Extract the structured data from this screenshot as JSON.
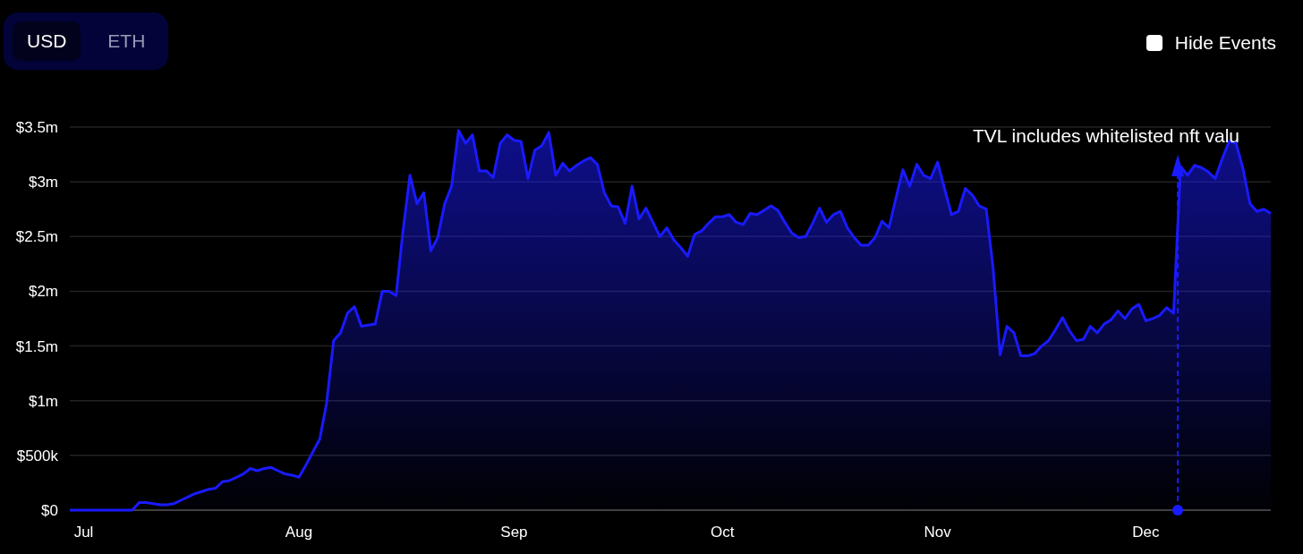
{
  "currency_toggle": [
    {
      "label": "USD",
      "selected": true
    },
    {
      "label": "ETH",
      "selected": false
    }
  ],
  "hide_events": {
    "label": "Hide Events",
    "checked": false
  },
  "chart_data": {
    "type": "area",
    "categories": [
      null,
      null,
      "Jul",
      null,
      null,
      null,
      null,
      null,
      null,
      null,
      null,
      null,
      null,
      null,
      null,
      null,
      null,
      null,
      null,
      null,
      null,
      null,
      null,
      null,
      null,
      null,
      null,
      null,
      null,
      null,
      null,
      null,
      null,
      "Aug",
      null,
      null,
      null,
      null,
      null,
      null,
      null,
      null,
      null,
      null,
      null,
      null,
      null,
      null,
      null,
      null,
      null,
      null,
      null,
      null,
      null,
      null,
      null,
      null,
      null,
      null,
      null,
      null,
      null,
      null,
      "Sep",
      null,
      null,
      null,
      null,
      null,
      null,
      null,
      null,
      null,
      null,
      null,
      null,
      null,
      null,
      null,
      null,
      null,
      null,
      null,
      null,
      null,
      null,
      null,
      null,
      null,
      null,
      null,
      null,
      null,
      "Oct",
      null,
      null,
      null,
      null,
      null,
      null,
      null,
      null,
      null,
      null,
      null,
      null,
      null,
      null,
      null,
      null,
      null,
      null,
      null,
      null,
      null,
      null,
      null,
      null,
      null,
      null,
      null,
      null,
      null,
      null,
      "Nov",
      null,
      null,
      null,
      null,
      null,
      null,
      null,
      null,
      null,
      null,
      null,
      null,
      null,
      null,
      null,
      null,
      null,
      null,
      null,
      null,
      null,
      null,
      null,
      null,
      null,
      null,
      null,
      null,
      null,
      "Dec",
      null,
      null,
      null,
      null,
      null,
      null,
      null,
      null,
      null,
      null,
      null,
      null,
      null,
      null,
      null,
      null,
      null,
      null
    ],
    "series": [
      {
        "color": "#1a1aff",
        "values": [
          0,
          0,
          0,
          0,
          0,
          0,
          0,
          0,
          0,
          0,
          70000,
          70000,
          60000,
          50000,
          50000,
          60000,
          90000,
          120000,
          150000,
          170000,
          190000,
          200000,
          260000,
          270000,
          300000,
          330000,
          380000,
          360000,
          380000,
          390000,
          360000,
          330000,
          320000,
          300000,
          410000,
          530000,
          650000,
          980000,
          1550000,
          1620000,
          1800000,
          1860000,
          1680000,
          1690000,
          1700000,
          2000000,
          2000000,
          1960000,
          2550000,
          3060000,
          2800000,
          2900000,
          2370000,
          2490000,
          2800000,
          2960000,
          3470000,
          3350000,
          3430000,
          3100000,
          3100000,
          3040000,
          3350000,
          3430000,
          3380000,
          3370000,
          3030000,
          3290000,
          3330000,
          3450000,
          3060000,
          3170000,
          3100000,
          3150000,
          3190000,
          3220000,
          3160000,
          2900000,
          2780000,
          2770000,
          2620000,
          2960000,
          2660000,
          2760000,
          2630000,
          2500000,
          2580000,
          2470000,
          2400000,
          2320000,
          2520000,
          2550000,
          2620000,
          2680000,
          2680000,
          2700000,
          2630000,
          2610000,
          2710000,
          2700000,
          2740000,
          2780000,
          2740000,
          2630000,
          2530000,
          2490000,
          2500000,
          2620000,
          2760000,
          2630000,
          2700000,
          2730000,
          2580000,
          2490000,
          2420000,
          2420000,
          2490000,
          2640000,
          2580000,
          2850000,
          3110000,
          2960000,
          3160000,
          3060000,
          3030000,
          3180000,
          2940000,
          2700000,
          2730000,
          2940000,
          2880000,
          2780000,
          2750000,
          2210000,
          1420000,
          1680000,
          1620000,
          1410000,
          1410000,
          1430000,
          1500000,
          1550000,
          1650000,
          1760000,
          1640000,
          1550000,
          1560000,
          1680000,
          1620000,
          1700000,
          1740000,
          1820000,
          1750000,
          1840000,
          1880000,
          1730000,
          1750000,
          1780000,
          1850000,
          1800000,
          3140000,
          3060000,
          3150000,
          3130000,
          3090000,
          3030000,
          3210000,
          3370000,
          3350000,
          3120000,
          2800000,
          2730000,
          2750000,
          2710000
        ]
      }
    ],
    "ylim": [
      0,
      3500000
    ],
    "grid": true,
    "yticks": [
      {
        "value": 0,
        "label": "$0"
      },
      {
        "value": 500000,
        "label": "$500k"
      },
      {
        "value": 1000000,
        "label": "$1m"
      },
      {
        "value": 1500000,
        "label": "$1.5m"
      },
      {
        "value": 2000000,
        "label": "$2m"
      },
      {
        "value": 2500000,
        "label": "$2.5m"
      },
      {
        "value": 3000000,
        "label": "$3m"
      },
      {
        "value": 3500000,
        "label": "$3.5m"
      }
    ],
    "annotations": [
      "TVL includes whitelisted nft valu"
    ]
  }
}
